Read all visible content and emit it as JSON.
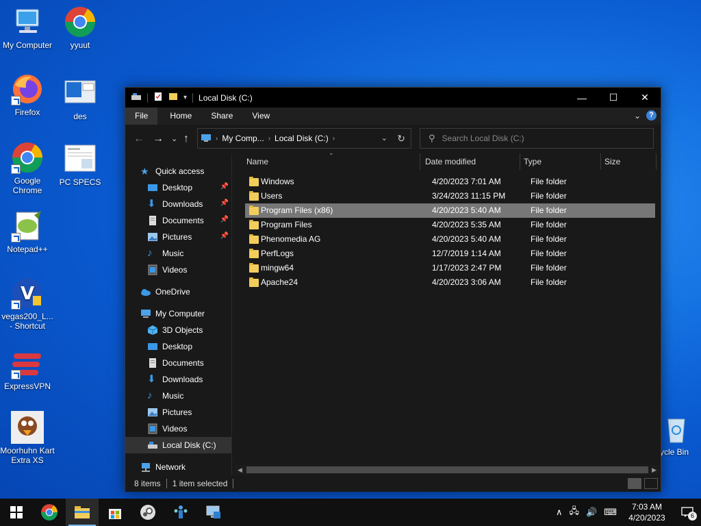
{
  "desktop": {
    "icons": [
      {
        "label": "My Computer"
      },
      {
        "label": "yyuut"
      },
      {
        "label": "Firefox"
      },
      {
        "label": "des"
      },
      {
        "label": "Google Chrome"
      },
      {
        "label": "PC SPECS"
      },
      {
        "label": "Notepad++"
      },
      {
        "label": "vegas200_L... - Shortcut"
      },
      {
        "label": "ExpressVPN"
      },
      {
        "label": "Moorhuhn Kart Extra XS"
      },
      {
        "label": "ycle Bin"
      }
    ]
  },
  "window": {
    "title": "Local Disk (C:)",
    "controls": {
      "minimize": "—",
      "maximize": "☐",
      "close": "✕"
    },
    "ribbon_tabs": [
      "File",
      "Home",
      "Share",
      "View"
    ],
    "help": "?",
    "address": {
      "crumbs": [
        "My Comp...",
        "Local Disk (C:)"
      ]
    },
    "search": {
      "placeholder": "Search Local Disk (C:)"
    },
    "nav_pane": {
      "quick_access": "Quick access",
      "quick_items": [
        "Desktop",
        "Downloads",
        "Documents",
        "Pictures",
        "Music",
        "Videos"
      ],
      "onedrive": "OneDrive",
      "my_computer": "My Computer",
      "pc_items": [
        "3D Objects",
        "Desktop",
        "Documents",
        "Downloads",
        "Music",
        "Pictures",
        "Videos",
        "Local Disk (C:)"
      ],
      "network": "Network"
    },
    "columns": {
      "name": "Name",
      "date": "Date modified",
      "type": "Type",
      "size": "Size"
    },
    "files": [
      {
        "name": "Windows",
        "date": "4/20/2023 7:01 AM",
        "type": "File folder"
      },
      {
        "name": "Users",
        "date": "3/24/2023 11:15 PM",
        "type": "File folder"
      },
      {
        "name": "Program Files (x86)",
        "date": "4/20/2023 5:40 AM",
        "type": "File folder"
      },
      {
        "name": "Program Files",
        "date": "4/20/2023 5:35 AM",
        "type": "File folder"
      },
      {
        "name": "Phenomedia AG",
        "date": "4/20/2023 5:40 AM",
        "type": "File folder"
      },
      {
        "name": "PerfLogs",
        "date": "12/7/2019 1:14 AM",
        "type": "File folder"
      },
      {
        "name": "mingw64",
        "date": "1/17/2023 2:47 PM",
        "type": "File folder"
      },
      {
        "name": "Apache24",
        "date": "4/20/2023 3:06 AM",
        "type": "File folder"
      }
    ],
    "status": {
      "count": "8 items",
      "selection": "1 item selected"
    }
  },
  "taskbar": {
    "time": "7:03 AM",
    "date": "4/20/2023",
    "notifications": "6"
  },
  "colors": {
    "accent": "#76b9ed",
    "folder": "#f2cd5b",
    "selection": "#777777"
  }
}
